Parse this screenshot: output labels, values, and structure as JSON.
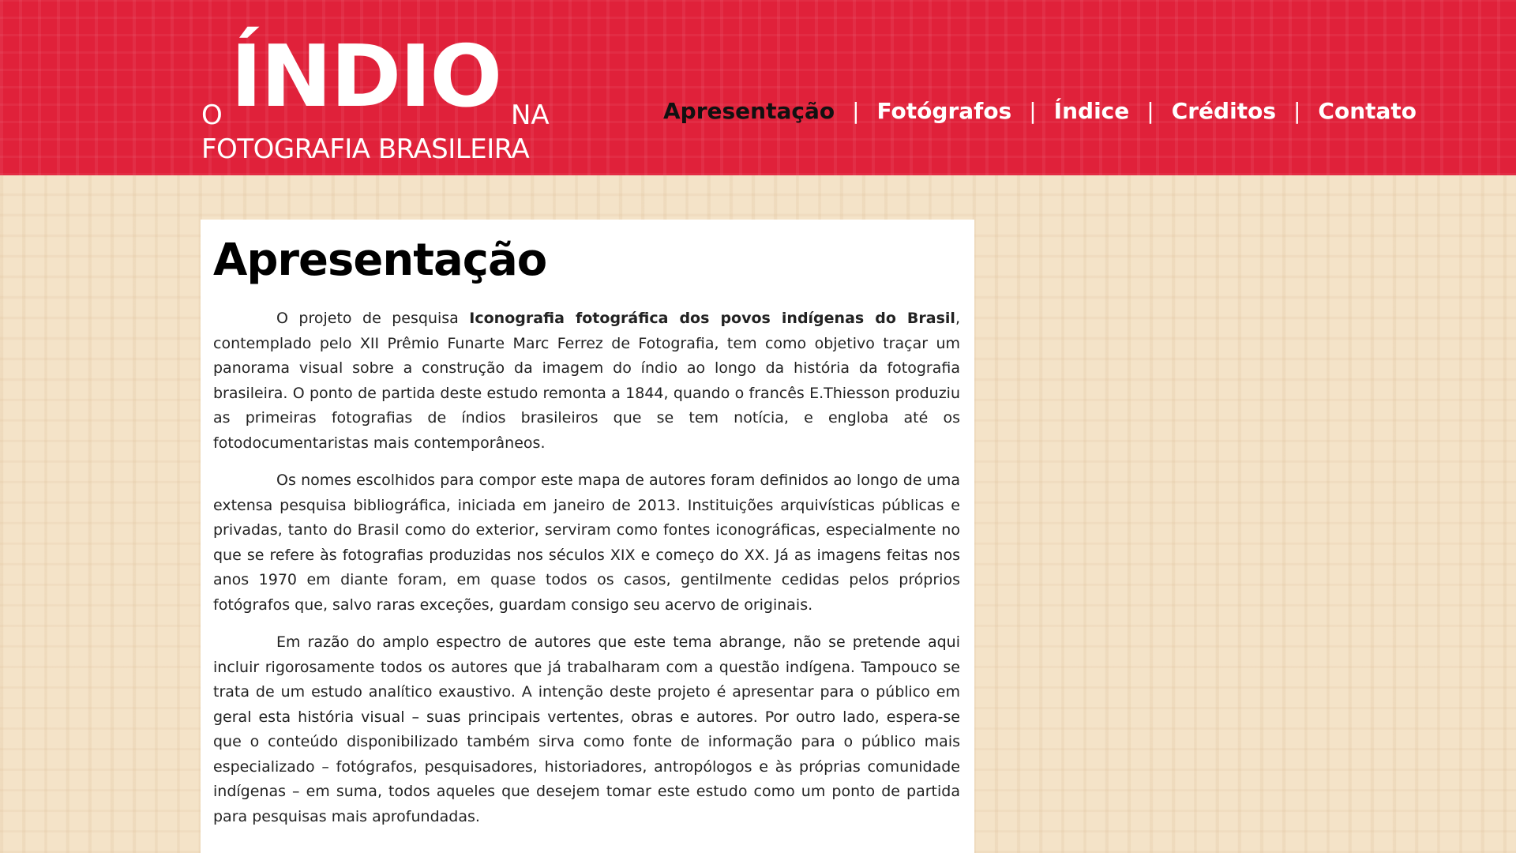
{
  "header": {
    "logo": {
      "o": "O",
      "indio": "ÍNDIO",
      "na": "NA",
      "subtitle": "FOTOGRAFIA BRASILEIRA"
    },
    "nav": {
      "items": [
        "Apresentação",
        "Fotógrafos",
        "Índice",
        "Créditos",
        "Contato"
      ],
      "separator": "|",
      "active_index": 0
    }
  },
  "main": {
    "title": "Apresentação",
    "paragraph1": {
      "before": "O projeto de pesquisa ",
      "bold": "Iconografia fotográfica dos povos indígenas do Brasil",
      "after": ", contemplado pelo XII Prêmio Funarte Marc Ferrez de Fotografia, tem como objetivo traçar um panorama visual sobre a construção da imagem do índio ao longo da história da fotografia brasileira. O ponto de partida deste estudo remonta a 1844, quando o francês E.Thiesson produziu as primeiras fotografias de índios brasileiros que se tem notícia, e engloba até os fotodocumentaristas mais contemporâneos."
    },
    "paragraph2": "Os nomes escolhidos para compor este mapa de autores foram definidos ao longo de uma extensa pesquisa bibliográfica, iniciada em janeiro de 2013. Instituições arquivísticas públicas e privadas, tanto do Brasil como do exterior, serviram como fontes iconográficas, especialmente no que se refere às fotografias produzidas nos séculos XIX e começo do XX. Já as imagens feitas nos anos 1970 em diante foram, em quase todos os casos, gentilmente cedidas pelos próprios fotógrafos que, salvo raras exceções, guardam consigo seu acervo de originais.",
    "paragraph3": "Em razão do amplo espectro de autores que este tema abrange, não se pretende aqui incluir rigorosamente todos os autores que já trabalharam com a questão indígena. Tampouco se trata de um estudo analítico exaustivo. A intenção deste projeto é apresentar para o público em geral esta história visual – suas principais vertentes, obras e autores. Por outro lado, espera-se que o conteúdo disponibilizado também sirva como fonte de informação para o público mais especializado – fotógrafos, pesquisadores, historiadores, antropólogos e às próprias comunidade indígenas – em suma, todos aqueles que desejem tomar este estudo como um ponto de partida para pesquisas mais aprofundadas."
  },
  "colors": {
    "header_bg": "#e0213a",
    "page_bg": "#f4e3c8",
    "active_nav": "#111111",
    "nav_text": "#ffffff"
  }
}
